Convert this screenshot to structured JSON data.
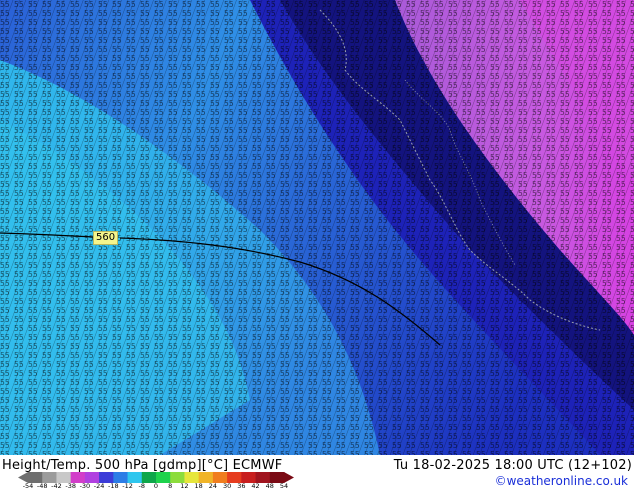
{
  "map": {
    "region_label": "560",
    "colors": {
      "cold_core": "#13137e",
      "deep_blue": "#1d1dbf",
      "mid_blue": "#2c6fe0",
      "light_blue": "#34a6ea",
      "cyan": "#33c6ee",
      "purple": "#a03ed8",
      "magenta": "#cc48e0",
      "border": "#9aa0b0",
      "contour_text": "#000000"
    }
  },
  "footer": {
    "title": "Height/Temp. 500 hPa [gdmp][°C] ECMWF",
    "valid_time": "Tu 18-02-2025 18:00 UTC (12+102)",
    "credit": "©weatheronline.co.uk"
  },
  "colorbar": {
    "ticks": [
      "-54",
      "-48",
      "-42",
      "-38",
      "-30",
      "-24",
      "-18",
      "-12",
      "-8",
      "0",
      "8",
      "12",
      "18",
      "24",
      "30",
      "36",
      "42",
      "48",
      "54"
    ],
    "colors": [
      "#6e6e6e",
      "#9b9b9b",
      "#c8c8c8",
      "#d23ec9",
      "#b040e0",
      "#3c3cd8",
      "#2c7de6",
      "#2ec6ee",
      "#0ea64a",
      "#1ed24c",
      "#8cdc3c",
      "#e6e63c",
      "#f0b428",
      "#f07d1e",
      "#e63c1e",
      "#c81e1e",
      "#a0141e",
      "#7a0a14"
    ]
  }
}
